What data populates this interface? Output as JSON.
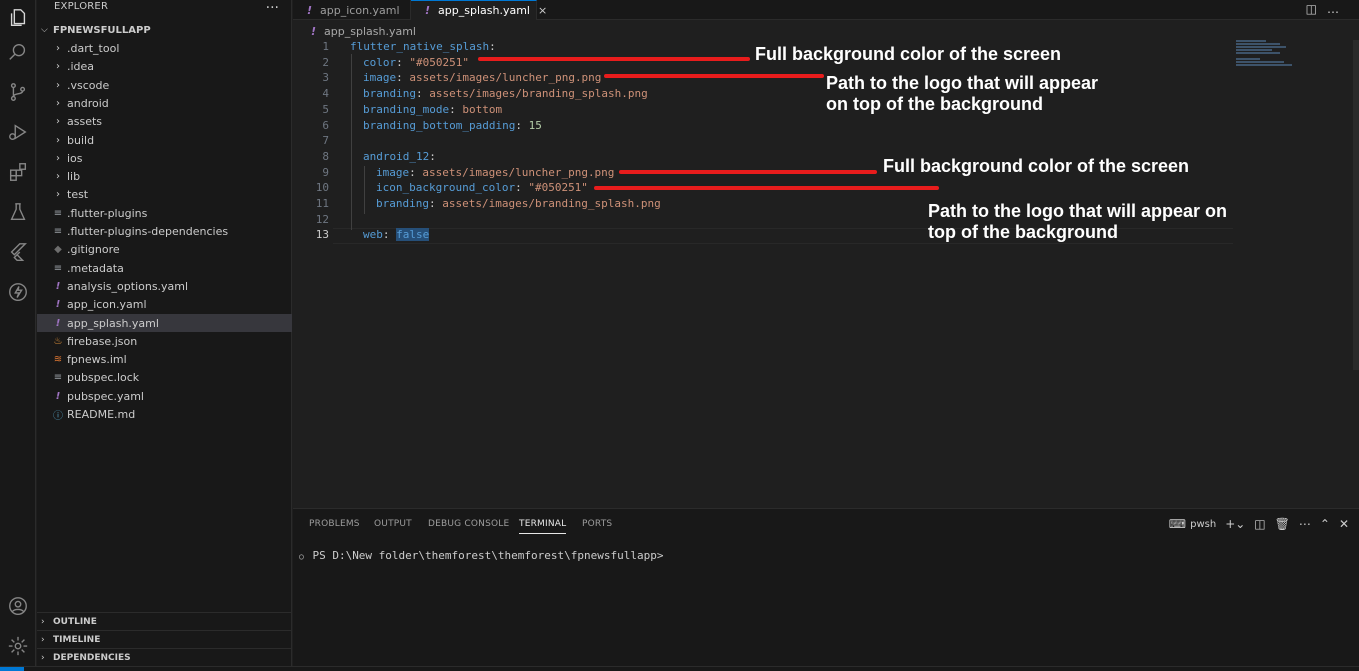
{
  "sidebar": {
    "title": "EXPLORER",
    "more": "···",
    "project": "FPNEWSFULLAPP",
    "items": [
      {
        "label": ".dart_tool",
        "kind": "folder"
      },
      {
        "label": ".idea",
        "kind": "folder"
      },
      {
        "label": ".vscode",
        "kind": "folder"
      },
      {
        "label": "android",
        "kind": "folder"
      },
      {
        "label": "assets",
        "kind": "folder"
      },
      {
        "label": "build",
        "kind": "folder"
      },
      {
        "label": "ios",
        "kind": "folder"
      },
      {
        "label": "lib",
        "kind": "folder"
      },
      {
        "label": "test",
        "kind": "folder"
      },
      {
        "label": ".flutter-plugins",
        "kind": "lines"
      },
      {
        "label": ".flutter-plugins-dependencies",
        "kind": "lines"
      },
      {
        "label": ".gitignore",
        "kind": "git"
      },
      {
        "label": ".metadata",
        "kind": "lines"
      },
      {
        "label": "analysis_options.yaml",
        "kind": "yaml"
      },
      {
        "label": "app_icon.yaml",
        "kind": "yaml"
      },
      {
        "label": "app_splash.yaml",
        "kind": "yaml",
        "selected": true
      },
      {
        "label": "firebase.json",
        "kind": "fire"
      },
      {
        "label": "fpnews.iml",
        "kind": "rss"
      },
      {
        "label": "pubspec.lock",
        "kind": "lines"
      },
      {
        "label": "pubspec.yaml",
        "kind": "yaml"
      },
      {
        "label": "README.md",
        "kind": "info"
      }
    ],
    "sections": [
      "OUTLINE",
      "TIMELINE",
      "DEPENDENCIES"
    ]
  },
  "tabs": [
    {
      "label": "app_icon.yaml",
      "active": false
    },
    {
      "label": "app_splash.yaml",
      "active": true
    }
  ],
  "tab_close": "×",
  "breadcrumb": "app_splash.yaml",
  "editor": {
    "current_line": 13,
    "lines": [
      {
        "n": "1",
        "key": "flutter_native_splash",
        "sep": ":",
        "val": "",
        "vtype": ""
      },
      {
        "n": "2",
        "key": "color",
        "sep": ": ",
        "val": "\"#050251\"",
        "vtype": "s"
      },
      {
        "n": "3",
        "key": "image",
        "sep": ": ",
        "val": "assets/images/luncher_png.png",
        "vtype": "s"
      },
      {
        "n": "4",
        "key": "branding",
        "sep": ": ",
        "val": "assets/images/branding_splash.png",
        "vtype": "s"
      },
      {
        "n": "5",
        "key": "branding_mode",
        "sep": ": ",
        "val": "bottom",
        "vtype": "s"
      },
      {
        "n": "6",
        "key": "branding_bottom_padding",
        "sep": ": ",
        "val": "15",
        "vtype": "n"
      },
      {
        "n": "7",
        "key": "",
        "sep": "",
        "val": "",
        "vtype": ""
      },
      {
        "n": "8",
        "key": "android_12",
        "sep": ":",
        "val": "",
        "vtype": ""
      },
      {
        "n": "9",
        "key": "image",
        "sep": ": ",
        "val": "assets/images/luncher_png.png",
        "vtype": "s"
      },
      {
        "n": "10",
        "key": "icon_background_color",
        "sep": ": ",
        "val": "\"#050251\"",
        "vtype": "s"
      },
      {
        "n": "11",
        "key": "branding",
        "sep": ": ",
        "val": "assets/images/branding_splash.png",
        "vtype": "s"
      },
      {
        "n": "12",
        "key": "",
        "sep": "",
        "val": "",
        "vtype": ""
      },
      {
        "n": "13",
        "key": "web",
        "sep": ": ",
        "val": "false",
        "vtype": "b"
      }
    ]
  },
  "annotations": [
    "Full background color of the screen",
    "Path to the logo that will appear",
    "on top of the background",
    "Full background color of the screen",
    "Path to the logo that will appear on",
    "top of the background"
  ],
  "panel": {
    "tabs": [
      "PROBLEMS",
      "OUTPUT",
      "DEBUG CONSOLE",
      "TERMINAL",
      "PORTS"
    ],
    "active_tab": "TERMINAL",
    "shell": "pwsh",
    "prompt": "PS D:\\New folder\\themforest\\themforest\\fpnewsfullapp>"
  },
  "colors": {
    "annotation_line": "#e81c1c",
    "accent": "#0078d4",
    "yaml_key": "#569cd6",
    "yaml_string": "#ce9178",
    "yaml_number": "#b5cea8"
  }
}
